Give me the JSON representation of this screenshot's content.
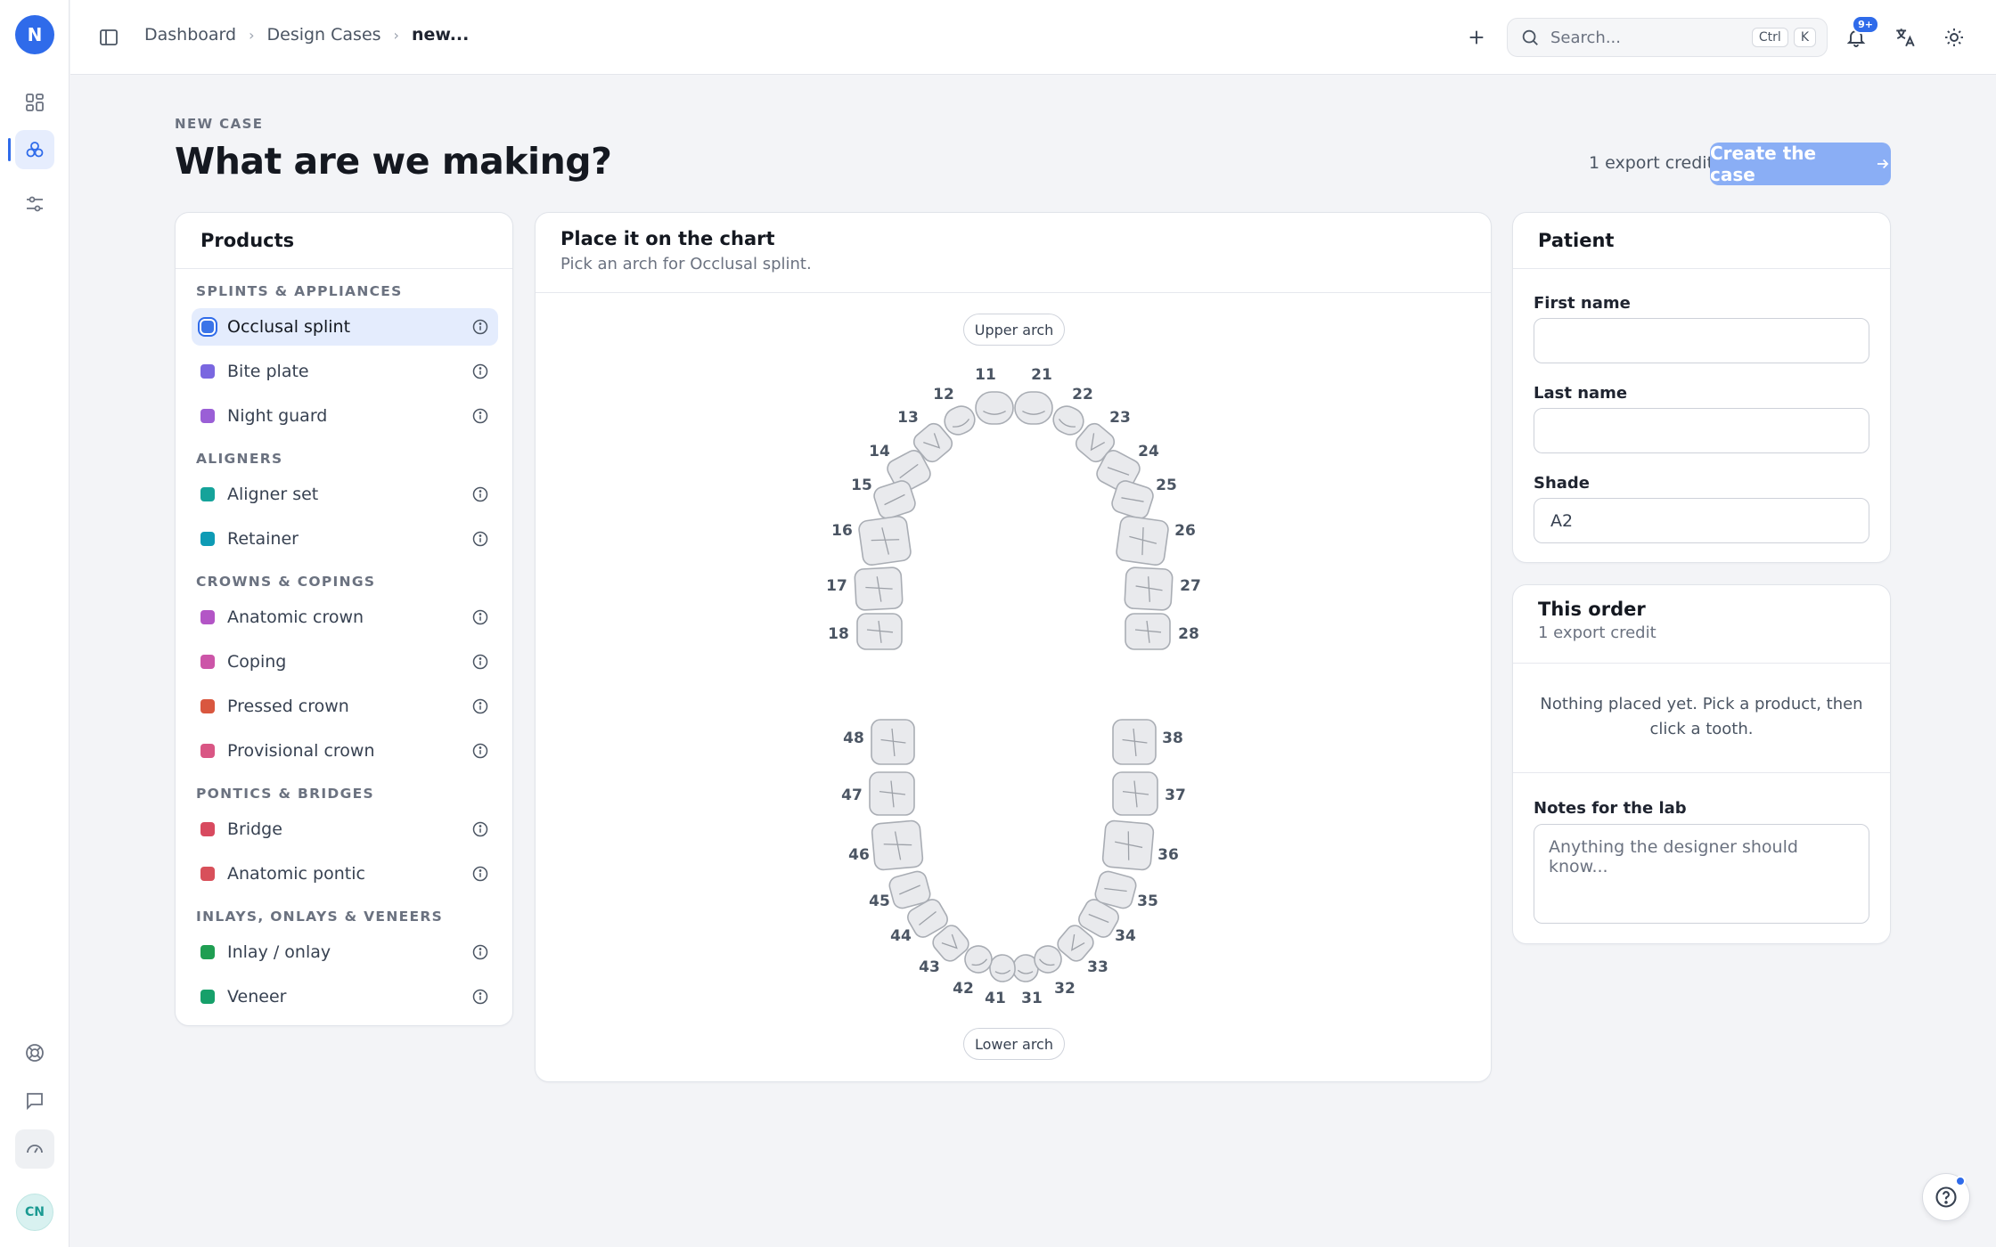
{
  "rail": {
    "logo_letter": "N",
    "avatar_initials": "CN"
  },
  "topbar": {
    "breadcrumbs": [
      "Dashboard",
      "Design Cases",
      "new..."
    ],
    "search_placeholder": "Search...",
    "shortcut_keys": [
      "Ctrl",
      "K"
    ],
    "notifications_badge": "9+"
  },
  "header": {
    "eyebrow": "NEW CASE",
    "title": "What are we making?",
    "credit_note": "1 export credit",
    "create_label": "Create the case"
  },
  "products": {
    "title": "Products",
    "groups": [
      {
        "label": "SPLINTS & APPLIANCES",
        "items": [
          {
            "label": "Occlusal splint",
            "color": "#3b74e8",
            "selected": true
          },
          {
            "label": "Bite plate",
            "color": "#7a67e0"
          },
          {
            "label": "Night guard",
            "color": "#9a5fd6"
          }
        ]
      },
      {
        "label": "ALIGNERS",
        "items": [
          {
            "label": "Aligner set",
            "color": "#15a39a"
          },
          {
            "label": "Retainer",
            "color": "#0e9bb5"
          }
        ]
      },
      {
        "label": "CROWNS & COPINGS",
        "items": [
          {
            "label": "Anatomic crown",
            "color": "#b355c6"
          },
          {
            "label": "Coping",
            "color": "#cc55a8"
          },
          {
            "label": "Pressed crown",
            "color": "#d9573f"
          },
          {
            "label": "Provisional crown",
            "color": "#d95684"
          }
        ]
      },
      {
        "label": "PONTICS & BRIDGES",
        "items": [
          {
            "label": "Bridge",
            "color": "#d84a5f"
          },
          {
            "label": "Anatomic pontic",
            "color": "#d8505a"
          }
        ]
      },
      {
        "label": "INLAYS, ONLAYS & VENEERS",
        "items": [
          {
            "label": "Inlay / onlay",
            "color": "#1f9e52"
          },
          {
            "label": "Veneer",
            "color": "#16a06a"
          }
        ]
      }
    ]
  },
  "chart": {
    "title": "Place it on the chart",
    "subtitle": "Pick an arch for Occlusal splint.",
    "upper_label": "Upper arch",
    "lower_label": "Lower arch",
    "tooth_numbers": [
      "11",
      "12",
      "13",
      "14",
      "15",
      "16",
      "17",
      "18",
      "21",
      "22",
      "23",
      "24",
      "25",
      "26",
      "27",
      "28",
      "31",
      "32",
      "33",
      "34",
      "35",
      "36",
      "37",
      "38",
      "41",
      "42",
      "43",
      "44",
      "45",
      "46",
      "47",
      "48"
    ]
  },
  "patient": {
    "title": "Patient",
    "first_name_label": "First name",
    "first_name_value": "",
    "last_name_label": "Last name",
    "last_name_value": "",
    "shade_label": "Shade",
    "shade_value": "A2"
  },
  "order": {
    "title": "This order",
    "subtitle": "1 export credit",
    "empty_text": "Nothing placed yet. Pick a product, then click a tooth.",
    "notes_label": "Notes for the lab",
    "notes_placeholder": "Anything the designer should know..."
  }
}
